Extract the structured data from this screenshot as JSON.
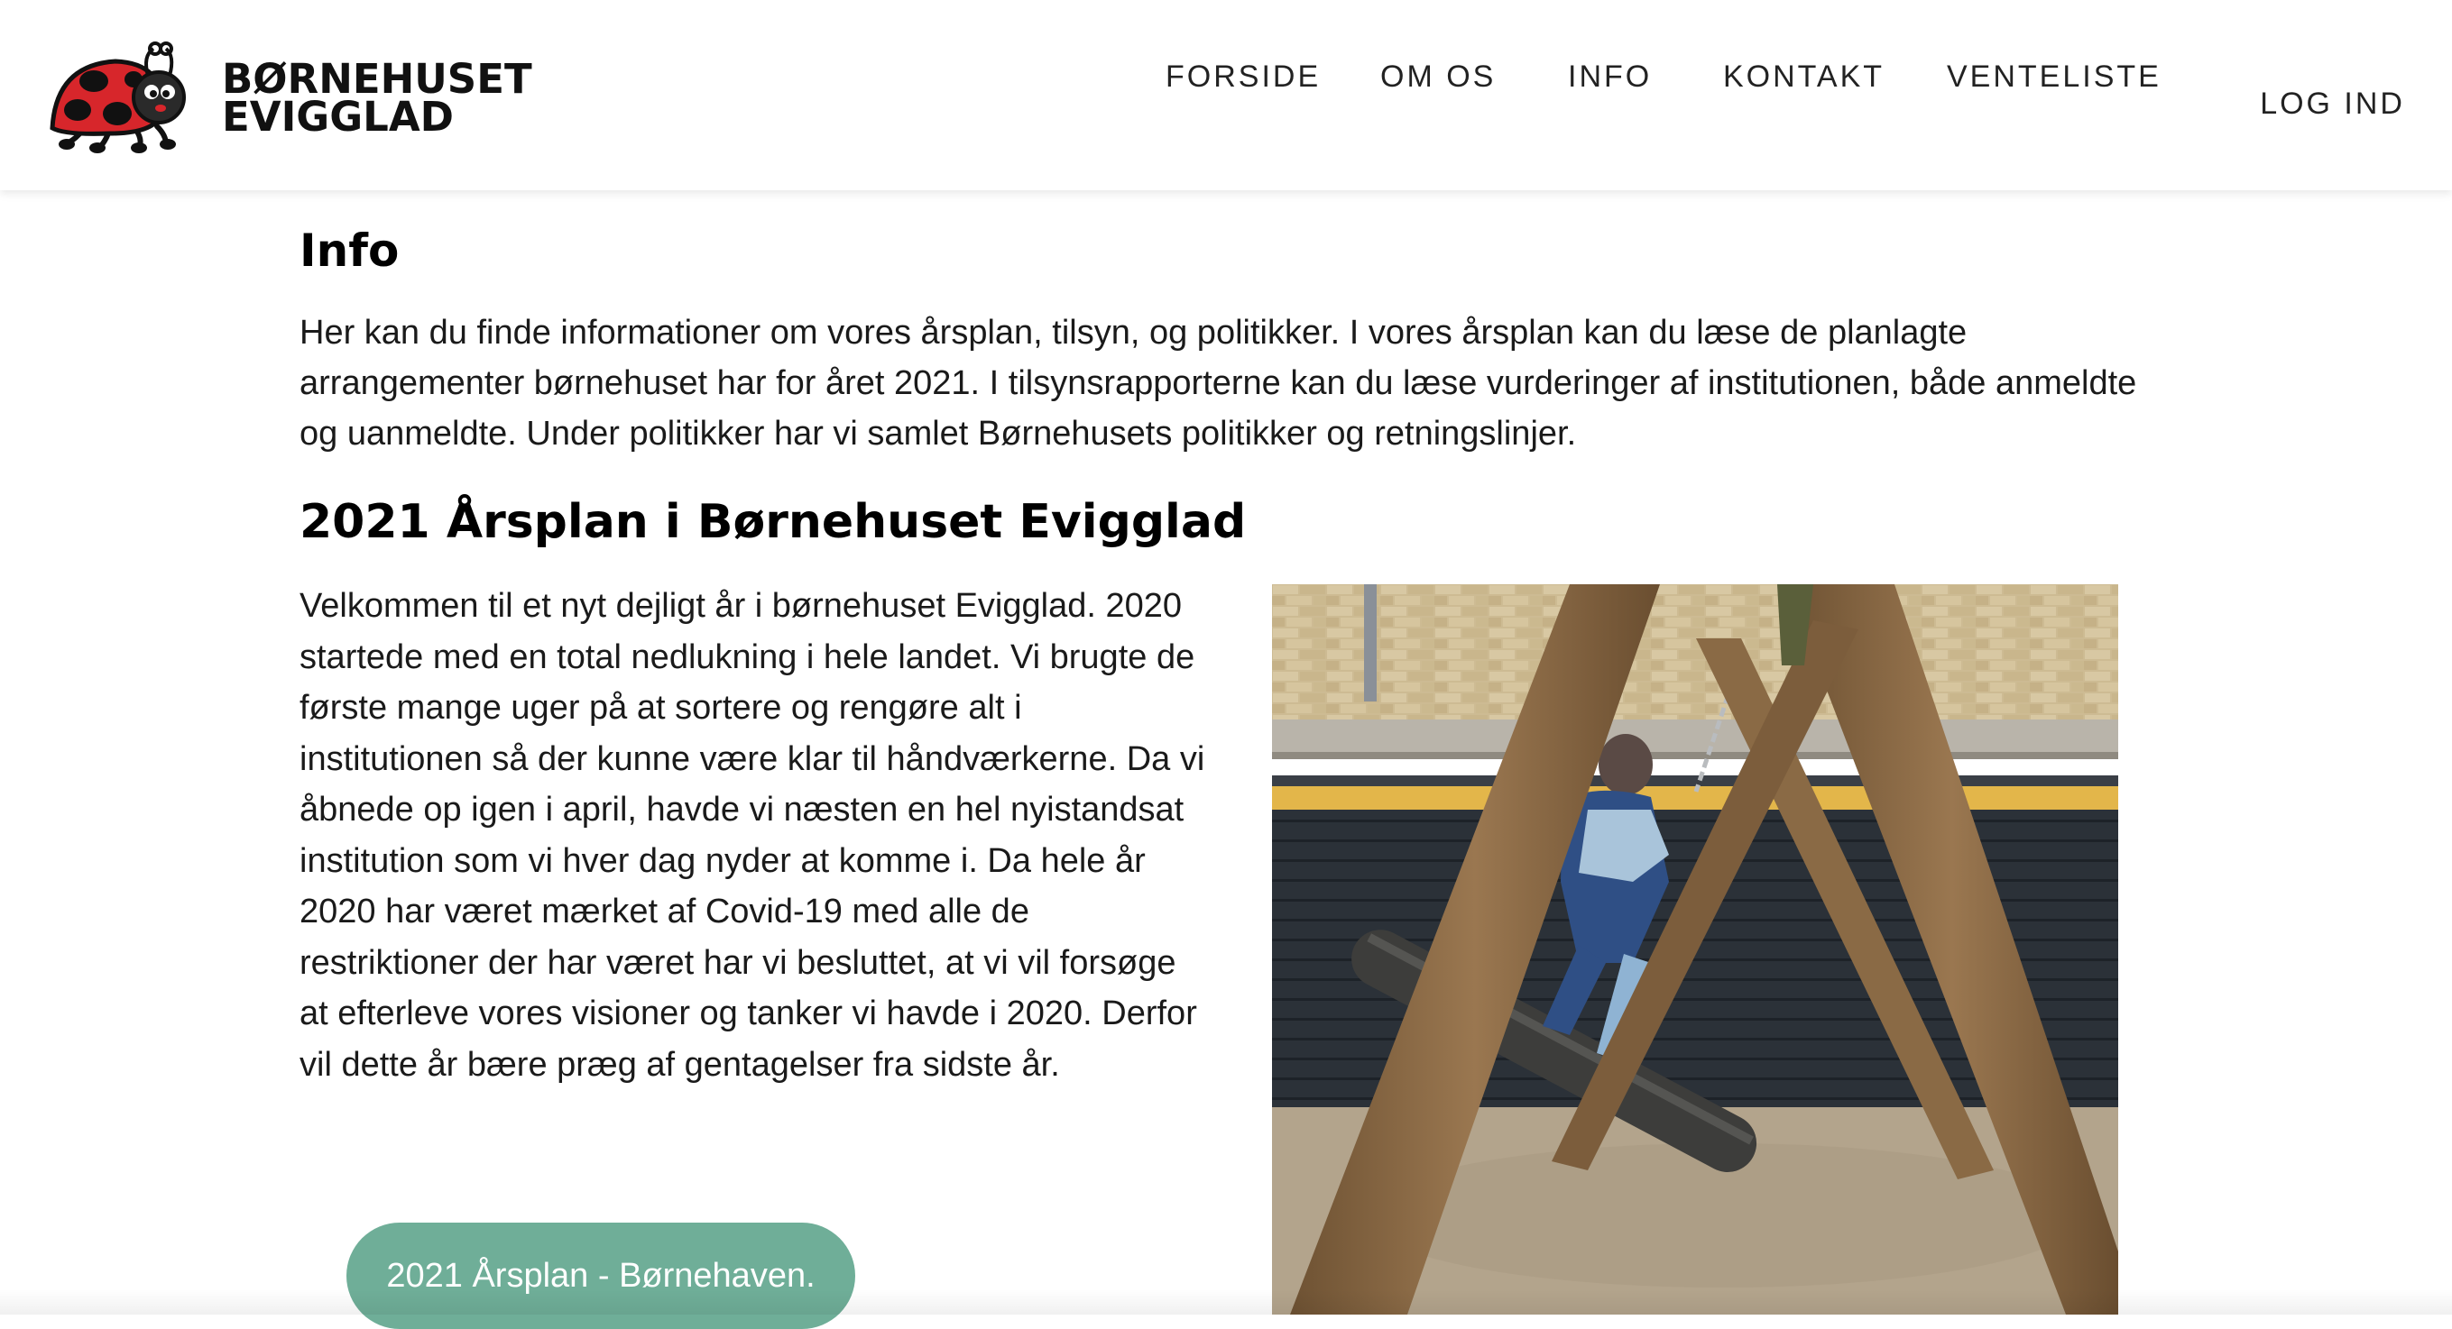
{
  "site": {
    "logo_line1": "BØRNEHUSET",
    "logo_line2": "EVIGGLAD"
  },
  "nav": {
    "items": [
      {
        "label": "FORSIDE"
      },
      {
        "label": "OM OS"
      },
      {
        "label": "INFO"
      },
      {
        "label": "KONTAKT"
      },
      {
        "label": "VENTELISTE"
      }
    ],
    "login_label": "LOG IND"
  },
  "main": {
    "title": "Info",
    "intro": "Her kan du finde informationer om vores årsplan, tilsyn, og politikker. I vores årsplan kan du læse de planlagte arrangementer børnehuset har for året 2021. I tilsynsrapporterne kan du læse vurderinger af institutionen, både anmeldte og uanmeldte. Under politikker har vi samlet Børnehusets politikker og retningslinjer.",
    "section_title": "2021 Årsplan i Børnehuset Evigglad",
    "section_body": "Velkommen til et nyt dejligt år i børnehuset Evigglad. 2020 startede med en total nedlukning i hele landet. Vi brugte de første mange uger på at sortere og rengøre alt i institutionen så der kunne være klar til håndværkerne. Da vi åbnede op igen i april, havde vi næsten en hel nyistandsat institution som vi hver dag nyder at komme i. Da hele år 2020 har været mærket af Covid-19 med alle de restriktioner der har været har vi besluttet, at vi vil forsøge at efterleve vores visioner og tanker vi havde i 2020. Derfor vil dette år bære præg af gentagelser fra sidste år.",
    "button_label": "2021 Årsplan - Børnehaven."
  },
  "colors": {
    "button": "#6fae98",
    "ladybug_red": "#d7262b"
  }
}
